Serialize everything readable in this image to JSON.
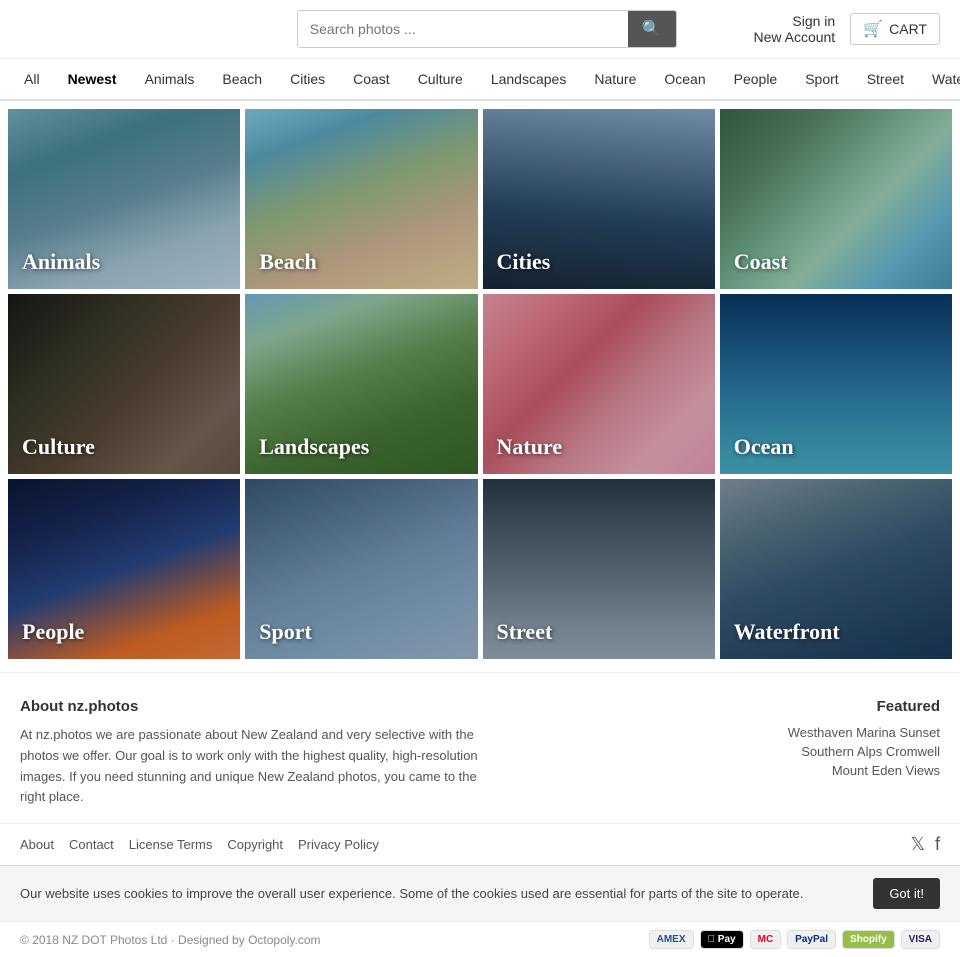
{
  "header": {
    "search_placeholder": "Search photos ...",
    "search_button_icon": "🔍",
    "sign_in": "Sign in",
    "new_account": "New Account",
    "cart": "CART"
  },
  "nav": {
    "items": [
      {
        "label": "All",
        "active": false
      },
      {
        "label": "Newest",
        "active": true
      },
      {
        "label": "Animals",
        "active": false
      },
      {
        "label": "Beach",
        "active": false
      },
      {
        "label": "Cities",
        "active": false
      },
      {
        "label": "Coast",
        "active": false
      },
      {
        "label": "Culture",
        "active": false
      },
      {
        "label": "Landscapes",
        "active": false
      },
      {
        "label": "Nature",
        "active": false
      },
      {
        "label": "Ocean",
        "active": false
      },
      {
        "label": "People",
        "active": false
      },
      {
        "label": "Sport",
        "active": false
      },
      {
        "label": "Street",
        "active": false
      },
      {
        "label": "Waterfront",
        "active": false
      }
    ]
  },
  "categories": [
    {
      "label": "Animals",
      "class": "cat-animals"
    },
    {
      "label": "Beach",
      "class": "cat-beach"
    },
    {
      "label": "Cities",
      "class": "cat-cities"
    },
    {
      "label": "Coast",
      "class": "cat-coast"
    },
    {
      "label": "Culture",
      "class": "cat-culture"
    },
    {
      "label": "Landscapes",
      "class": "cat-landscapes"
    },
    {
      "label": "Nature",
      "class": "cat-nature"
    },
    {
      "label": "Ocean",
      "class": "cat-ocean"
    },
    {
      "label": "People",
      "class": "cat-people"
    },
    {
      "label": "Sport",
      "class": "cat-sport"
    },
    {
      "label": "Street",
      "class": "cat-street"
    },
    {
      "label": "Waterfront",
      "class": "cat-waterfront"
    }
  ],
  "footer": {
    "about_title": "About nz.photos",
    "about_text": "At nz.photos we are passionate about New Zealand and very selective with the photos we offer. Our goal is to work only with the highest quality, high-resolution images. If you need stunning and unique New Zealand photos, you came to the right place.",
    "featured_title": "Featured",
    "featured_links": [
      "Westhaven Marina Sunset",
      "Southern Alps Cromwell",
      "Mount Eden Views"
    ],
    "links": [
      "About",
      "Contact",
      "License Terms",
      "Copyright",
      "Privacy Policy"
    ],
    "copy": "© 2018 NZ DOT Photos Ltd · Designed by Octopoly.com",
    "cookie_text": "Our website uses cookies to improve the overall user experience. Some of the cookies used are essential for parts of the site to operate.",
    "cookie_btn": "Got it!",
    "payment_methods": [
      "AMEX",
      "Apple Pay",
      "VISA",
      "MasterCard",
      "Shopify",
      "VISA"
    ]
  }
}
